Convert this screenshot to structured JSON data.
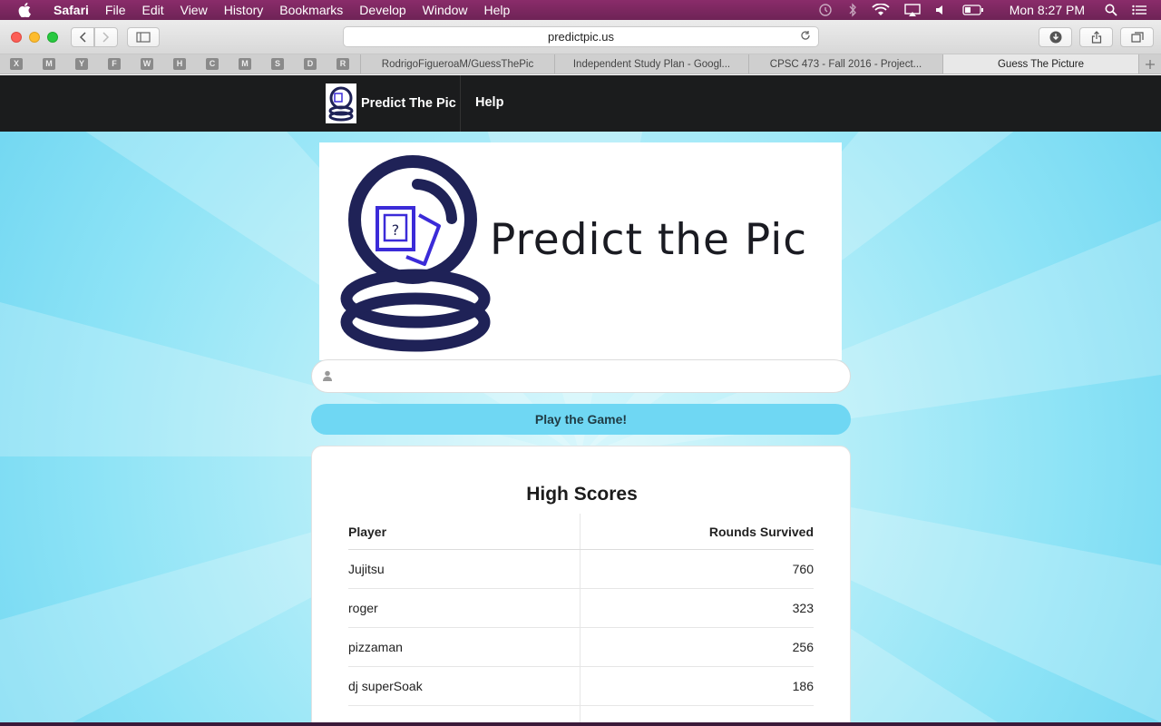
{
  "menubar": {
    "app": "Safari",
    "items": [
      "File",
      "Edit",
      "View",
      "History",
      "Bookmarks",
      "Develop",
      "Window",
      "Help"
    ],
    "clock": "Mon 8:27 PM"
  },
  "browser": {
    "url": "predictpic.us",
    "pinned_tabs": [
      "X",
      "M",
      "Y",
      "F",
      "W",
      "H",
      "C",
      "M",
      "S",
      "D",
      "R"
    ],
    "tabs": [
      {
        "label": "RodrigoFigueroaM/GuessThePic",
        "active": false
      },
      {
        "label": "Independent Study Plan - Googl...",
        "active": false
      },
      {
        "label": "CPSC 473 - Fall 2016 - Project...",
        "active": false
      },
      {
        "label": "Guess The Picture",
        "active": true
      }
    ]
  },
  "site": {
    "brand": "Predict The Pic",
    "nav_help": "Help",
    "hero_title": "Predict the Pic",
    "name_input": {
      "value": "",
      "placeholder": ""
    },
    "play_button": "Play the Game!",
    "scores": {
      "title": "High Scores",
      "col_player": "Player",
      "col_rounds": "Rounds Survived",
      "rows": [
        {
          "player": "Jujitsu",
          "rounds": "760"
        },
        {
          "player": "roger",
          "rounds": "323"
        },
        {
          "player": "pizzaman",
          "rounds": "256"
        },
        {
          "player": "dj superSoak",
          "rounds": "186"
        }
      ]
    }
  },
  "colors": {
    "navbar": "#1b1c1d",
    "accent": "#6fd7f3",
    "logo_navy": "#1f2257",
    "logo_purple": "#3b2bd8"
  }
}
